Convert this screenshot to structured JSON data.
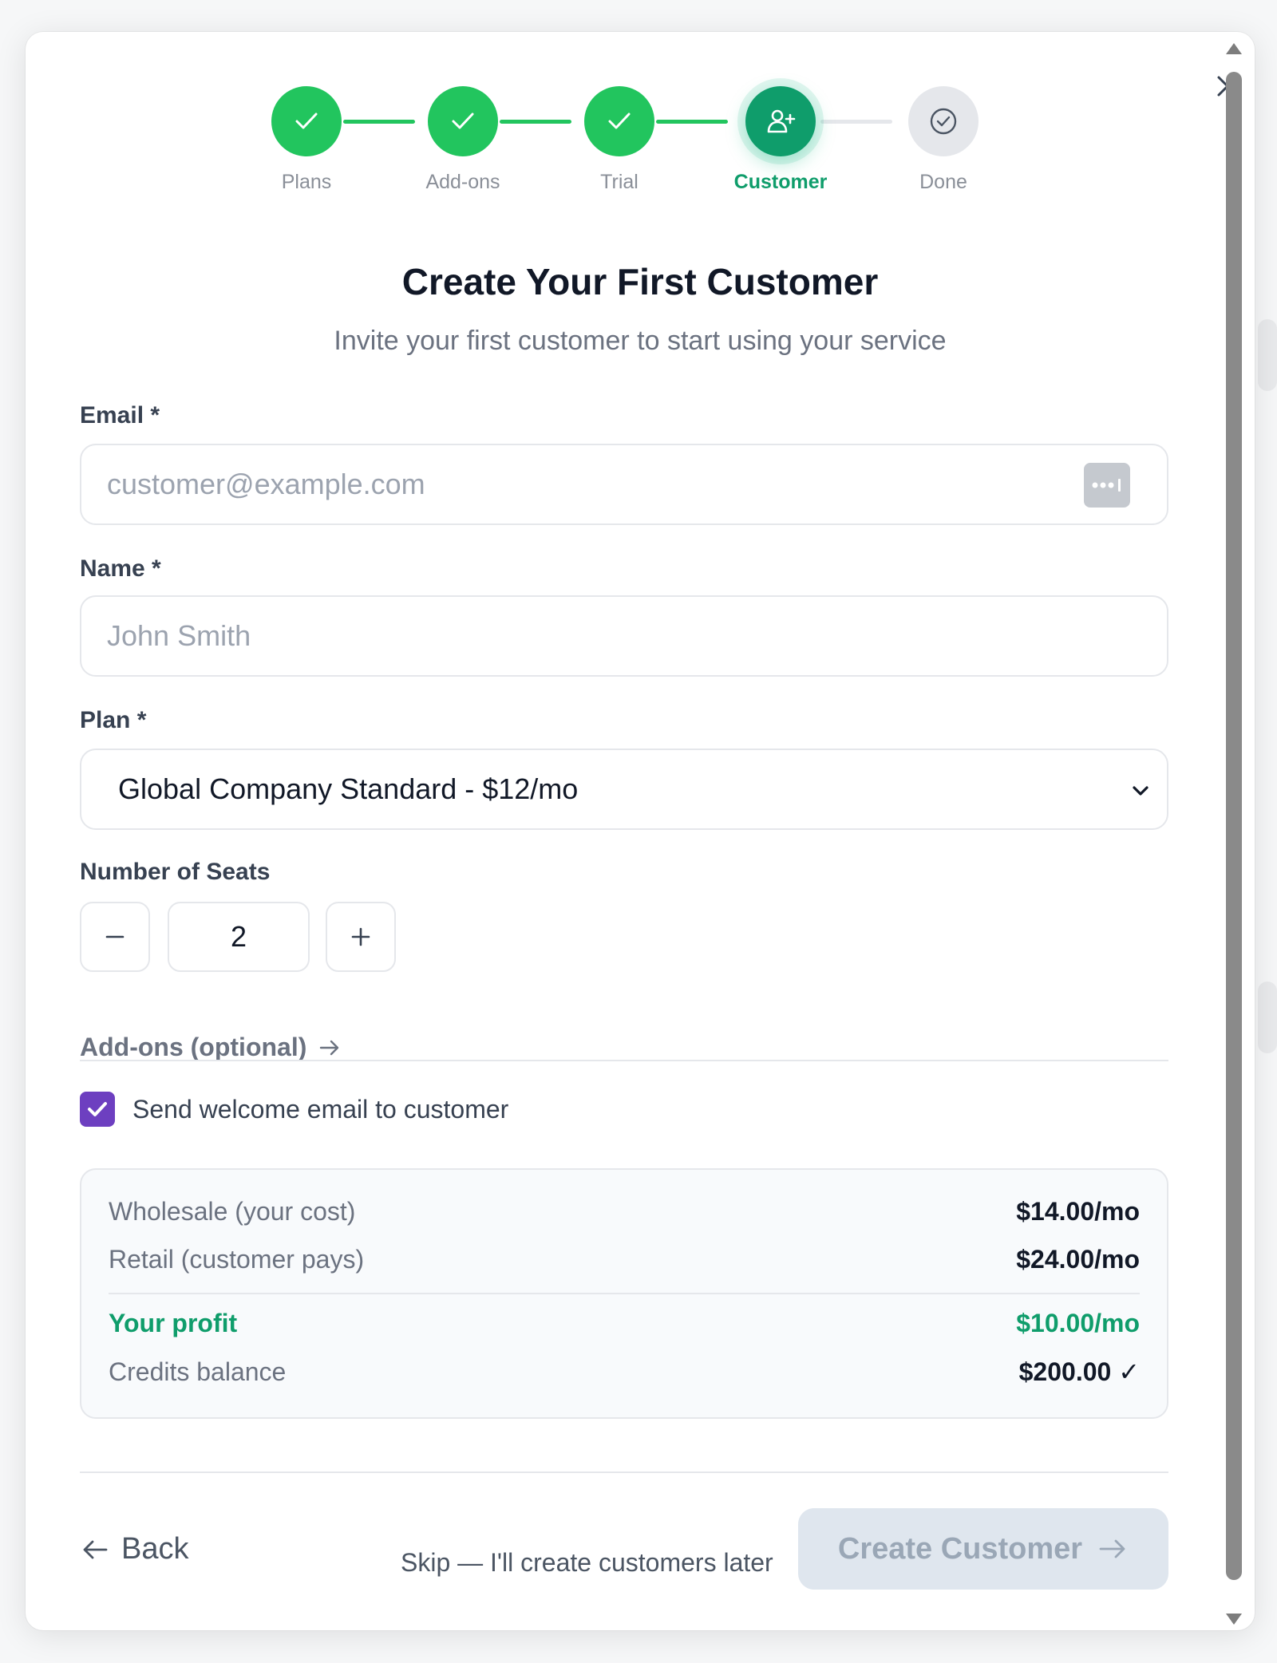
{
  "stepper": {
    "steps": [
      {
        "label": "Plans",
        "state": "done"
      },
      {
        "label": "Add-ons",
        "state": "done"
      },
      {
        "label": "Trial",
        "state": "done"
      },
      {
        "label": "Customer",
        "state": "active"
      },
      {
        "label": "Done",
        "state": "pending"
      }
    ]
  },
  "header": {
    "title": "Create Your First Customer",
    "subtitle": "Invite your first customer to start using your service"
  },
  "form": {
    "email": {
      "label": "Email *",
      "placeholder": "customer@example.com",
      "value": ""
    },
    "name": {
      "label": "Name *",
      "placeholder": "John Smith",
      "value": ""
    },
    "plan": {
      "label": "Plan *",
      "selected": "Global Company Standard - $12/mo"
    },
    "seats": {
      "label": "Number of Seats",
      "value": "2"
    },
    "addons_link": "Add-ons (optional)",
    "welcome_email": {
      "label": "Send welcome email to customer",
      "checked": true
    }
  },
  "summary": {
    "wholesale_label": "Wholesale (your cost)",
    "wholesale_value": "$14.00/mo",
    "retail_label": "Retail (customer pays)",
    "retail_value": "$24.00/mo",
    "profit_label": "Your profit",
    "profit_value": "$10.00/mo",
    "credits_label": "Credits balance",
    "credits_value": "$200.00 ✓"
  },
  "footer": {
    "back_label": "Back",
    "skip_label": "Skip — I'll create customers later",
    "create_label": "Create Customer"
  },
  "colors": {
    "success": "#22c55e",
    "active_step": "#0f9d6b",
    "checkbox": "#6d3fc0",
    "disabled_button": "#dfe6ee"
  }
}
